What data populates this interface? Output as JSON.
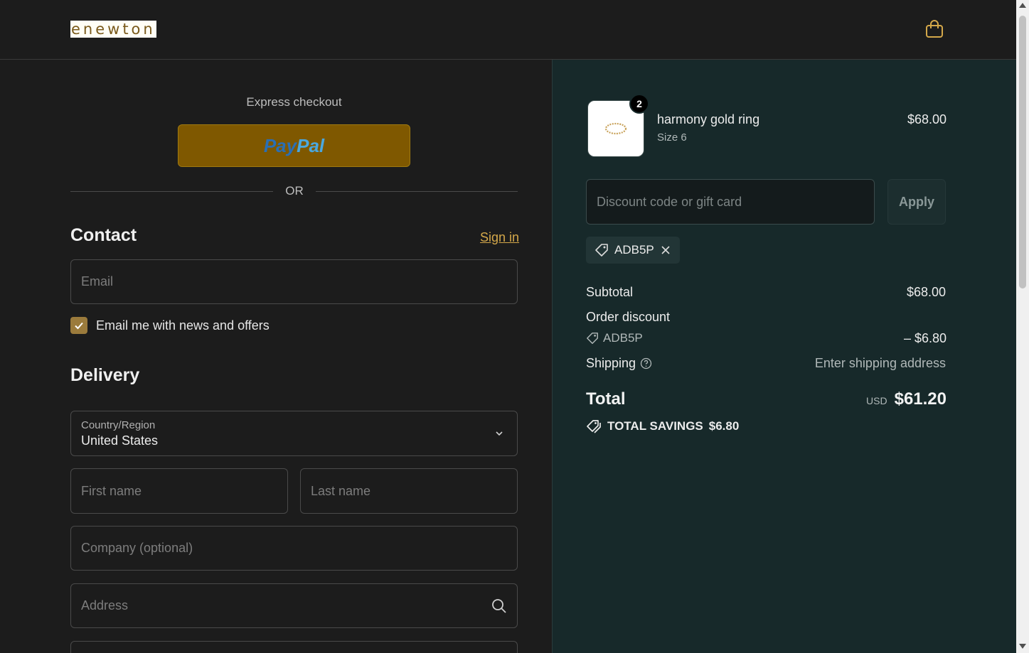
{
  "header": {
    "logo_text": "enewton",
    "cart_icon": "shopping-bag-icon"
  },
  "express": {
    "title": "Express checkout",
    "paypal_pay": "Pay",
    "paypal_pal": "Pal",
    "or_text": "OR"
  },
  "contact": {
    "title": "Contact",
    "signin_label": "Sign in",
    "email_placeholder": "Email",
    "newsletter_label": "Email me with news and offers",
    "newsletter_checked": true
  },
  "delivery": {
    "title": "Delivery",
    "country_label": "Country/Region",
    "country_value": "United States",
    "first_name_placeholder": "First name",
    "last_name_placeholder": "Last name",
    "company_placeholder": "Company (optional)",
    "address_placeholder": "Address"
  },
  "summary": {
    "product": {
      "name": "harmony gold ring",
      "variant": "Size 6",
      "price": "$68.00",
      "quantity": "2"
    },
    "discount_placeholder": "Discount code or gift card",
    "apply_label": "Apply",
    "applied_code": "ADB5P",
    "subtotal_label": "Subtotal",
    "subtotal_value": "$68.00",
    "order_discount_label": "Order discount",
    "order_discount_code": "ADB5P",
    "order_discount_value": "– $6.80",
    "shipping_label": "Shipping",
    "shipping_value": "Enter shipping address",
    "total_label": "Total",
    "total_currency": "USD",
    "total_value": "$61.20",
    "savings_label": "TOTAL SAVINGS",
    "savings_value": "$6.80"
  },
  "colors": {
    "accent": "#d4a84a",
    "paypal_bg": "#7f5800",
    "summary_bg": "#17292a"
  }
}
